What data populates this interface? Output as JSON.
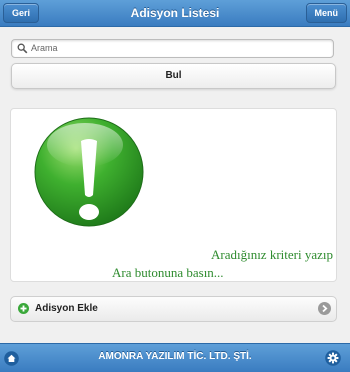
{
  "header": {
    "title": "Adisyon Listesi",
    "back_label": "Geri",
    "menu_label": "Menü"
  },
  "search": {
    "placeholder": "Arama",
    "value": ""
  },
  "find_button": {
    "label": "Bul"
  },
  "message": {
    "line1": "Aradığınız kriteri yazıp",
    "line2": "Ara butonuna basın..."
  },
  "add_item": {
    "label": "Adisyon Ekle"
  },
  "footer": {
    "title": "AMONRA YAZILIM TİC. LTD. ŞTİ."
  },
  "icons": {
    "search": "search-icon",
    "alert": "exclamation-icon",
    "add": "plus-icon",
    "chevron": "chevron-right-icon",
    "home": "home-icon",
    "settings": "gear-icon"
  },
  "colors": {
    "bar": "#3f82c6",
    "message_text": "#2e8b2e",
    "alert_green": "#3aa83a"
  }
}
